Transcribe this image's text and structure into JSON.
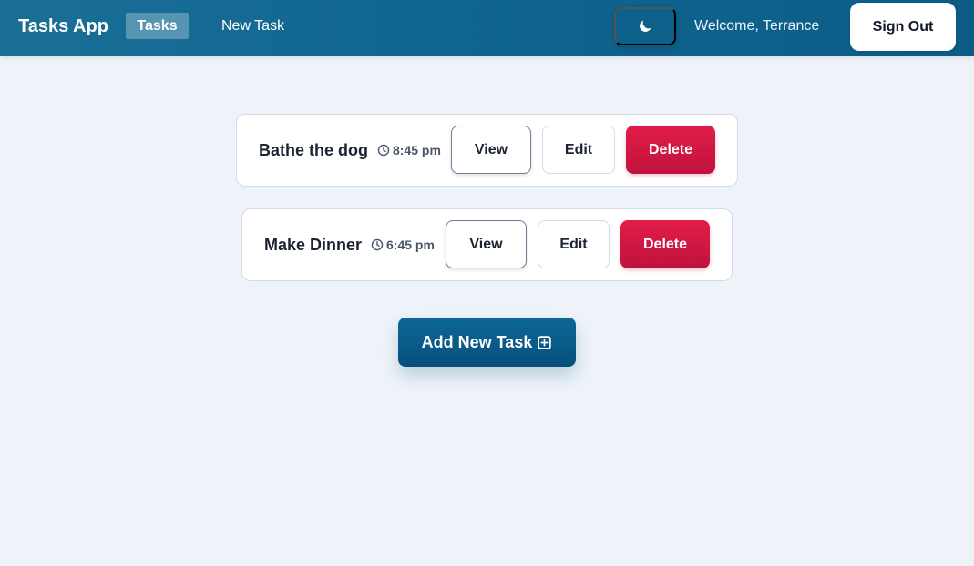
{
  "app": {
    "brand": "Tasks App",
    "nav": {
      "tasks_label": "Tasks",
      "new_task_label": "New Task"
    },
    "theme_toggle_icon": "moon-icon",
    "welcome_text": "Welcome, Terrance",
    "signout_label": "Sign Out"
  },
  "tasks": [
    {
      "title": "Bathe the dog",
      "time": "8:45 pm",
      "view_label": "View",
      "edit_label": "Edit",
      "delete_label": "Delete"
    },
    {
      "title": "Make Dinner",
      "time": "6:45 pm",
      "view_label": "View",
      "edit_label": "Edit",
      "delete_label": "Delete"
    }
  ],
  "add_task": {
    "label": "Add New Task",
    "icon": "plus-square-icon"
  },
  "colors": {
    "navbar": "#0f6690",
    "page_background": "#eef3f9",
    "delete": "#e11d48",
    "primary": "#0c6896"
  }
}
